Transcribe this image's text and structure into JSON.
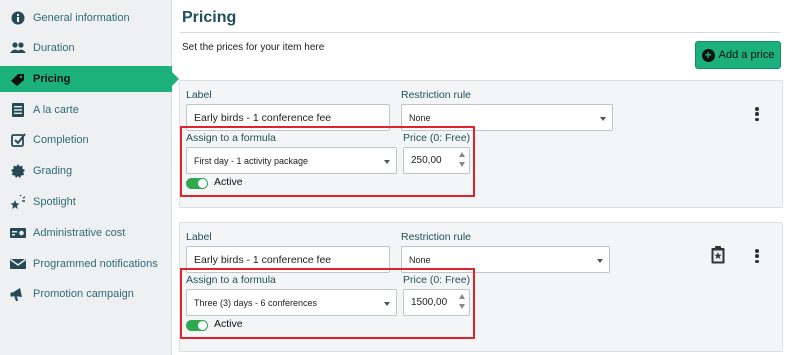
{
  "sidebar": {
    "items": [
      {
        "label": "General information",
        "icon": "info-circle-icon"
      },
      {
        "label": "Duration",
        "icon": "users-icon"
      },
      {
        "label": "Pricing",
        "icon": "tag-icon"
      },
      {
        "label": "A la carte",
        "icon": "menu-list-icon"
      },
      {
        "label": "Completion",
        "icon": "check-square-icon"
      },
      {
        "label": "Grading",
        "icon": "badge-icon"
      },
      {
        "label": "Spotlight",
        "icon": "sparkle-icon"
      },
      {
        "label": "Administrative cost",
        "icon": "money-card-icon"
      },
      {
        "label": "Programmed notifications",
        "icon": "envelope-icon"
      },
      {
        "label": "Promotion campaign",
        "icon": "megaphone-icon"
      }
    ],
    "active_index": 2
  },
  "main": {
    "title": "Pricing",
    "subtitle": "Set the prices for your item here",
    "add_button": "Add a price"
  },
  "prices": [
    {
      "label_caption": "Label",
      "label_value": "Early birds - 1 conference fee",
      "restriction_caption": "Restriction rule",
      "restriction_value": "None",
      "formula_caption": "Assign to a formula",
      "formula_value": "First day - 1 activity package",
      "price_caption": "Price (0: Free)",
      "price_value": "250,00",
      "active_label": "Active"
    },
    {
      "label_caption": "Label",
      "label_value": "Early birds - 1 conference fee",
      "restriction_caption": "Restriction rule",
      "restriction_value": "None",
      "formula_caption": "Assign to a formula",
      "formula_value": "Three (3) days - 6 conferences",
      "price_caption": "Price (0: Free)",
      "price_value": "1500,00",
      "active_label": "Active"
    }
  ],
  "colors": {
    "accent": "#1bb07c",
    "highlight_border": "#e0242e",
    "toggle_on": "#2fa84f",
    "heading": "#1f4f5c"
  }
}
